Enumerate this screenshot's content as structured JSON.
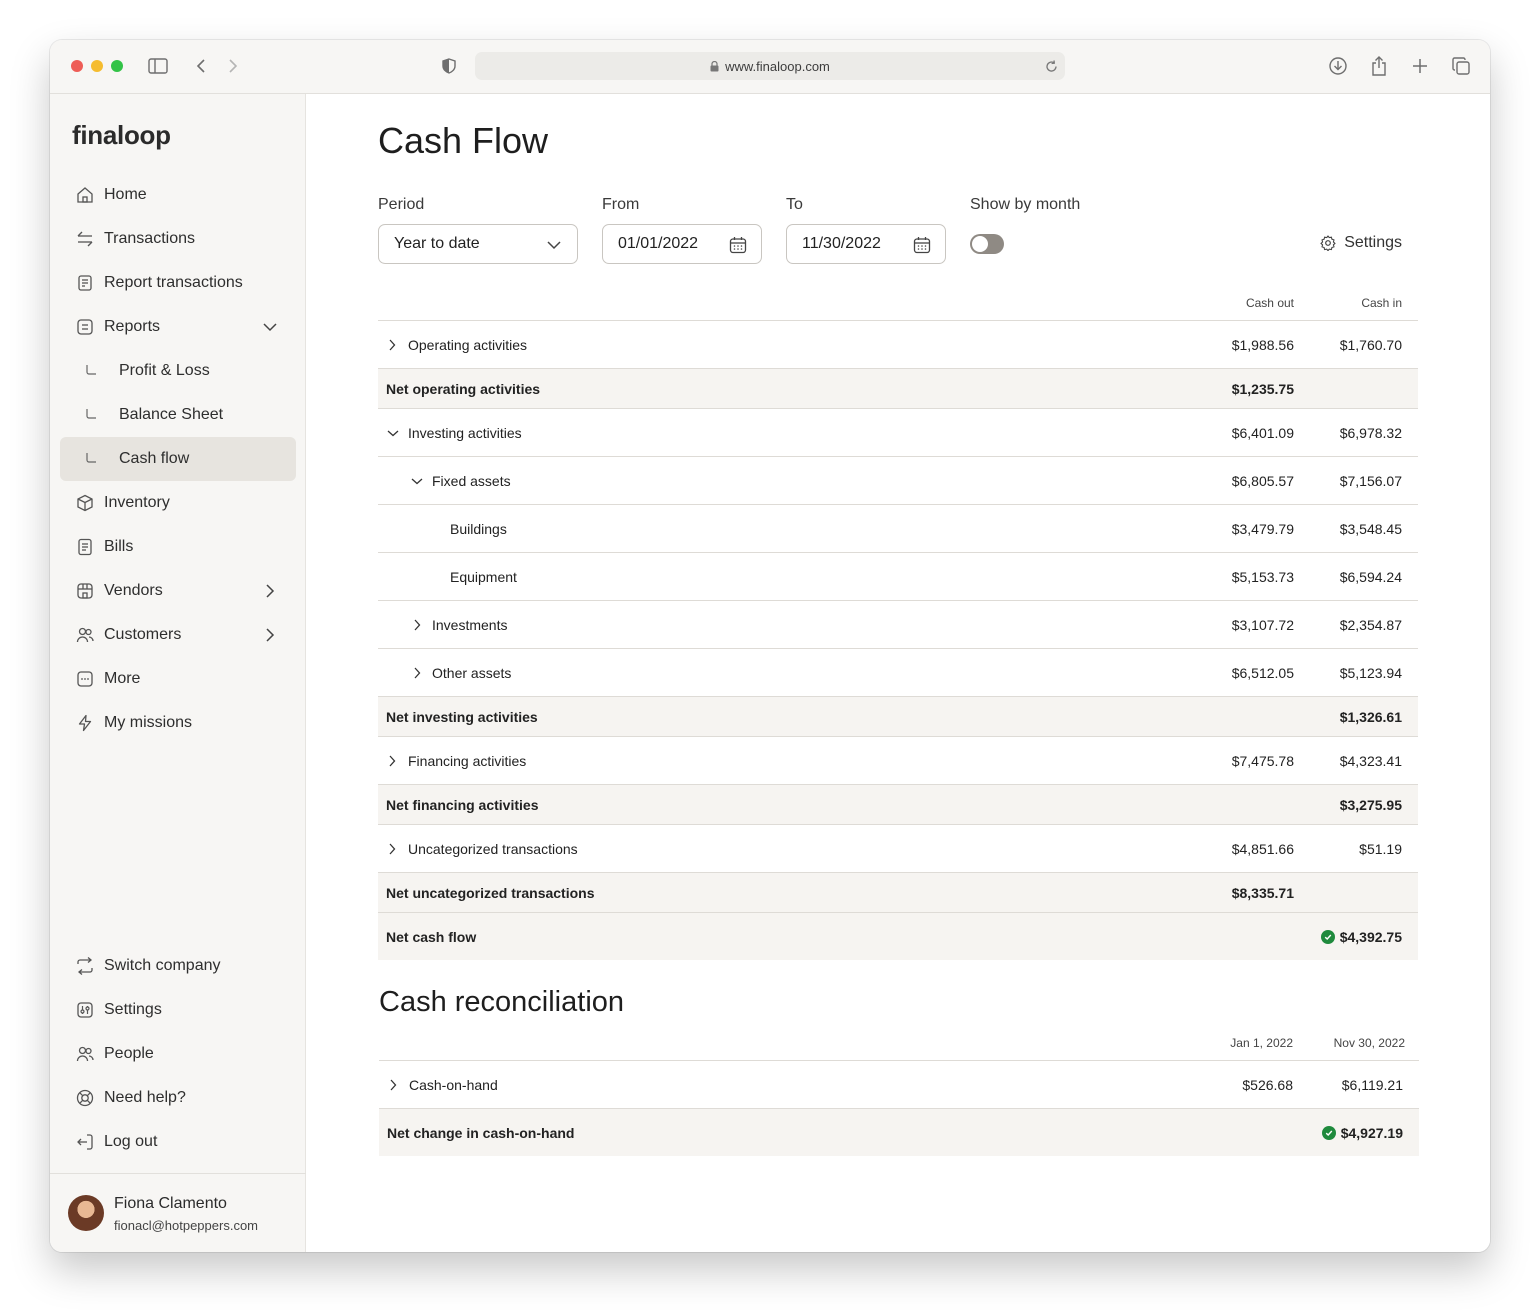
{
  "browser": {
    "url": "www.finaloop.com"
  },
  "sidebar": {
    "logo": "finaloop",
    "items": [
      {
        "label": "Home"
      },
      {
        "label": "Transactions"
      },
      {
        "label": "Report transactions"
      },
      {
        "label": "Reports"
      },
      {
        "label": "Profit & Loss"
      },
      {
        "label": "Balance Sheet"
      },
      {
        "label": "Cash flow"
      },
      {
        "label": "Inventory"
      },
      {
        "label": "Bills"
      },
      {
        "label": "Vendors"
      },
      {
        "label": "Customers"
      },
      {
        "label": "More"
      },
      {
        "label": "My missions"
      }
    ],
    "bottom_items": [
      {
        "label": "Switch company"
      },
      {
        "label": "Settings"
      },
      {
        "label": "People"
      },
      {
        "label": "Need help?"
      },
      {
        "label": "Log out"
      }
    ],
    "user": {
      "name": "Fiona Clamento",
      "email": "fionacl@hotpeppers.com"
    }
  },
  "main": {
    "title": "Cash Flow",
    "filters": {
      "period_label": "Period",
      "period_value": "Year to date",
      "from_label": "From",
      "from_value": "01/01/2022",
      "to_label": "To",
      "to_value": "11/30/2022",
      "show_by_month_label": "Show by month",
      "show_by_month_on": false,
      "settings_label": "Settings"
    },
    "cashflow": {
      "col_out": "Cash out",
      "col_in": "Cash in",
      "rows": [
        {
          "label": "Operating activities",
          "out": "$1,988.56",
          "in": "$1,760.70"
        },
        {
          "label": "Net operating activities",
          "out": "$1,235.75",
          "in": ""
        },
        {
          "label": "Investing activities",
          "out": "$6,401.09",
          "in": "$6,978.32"
        },
        {
          "label": "Fixed assets",
          "out": "$6,805.57",
          "in": "$7,156.07"
        },
        {
          "label": "Buildings",
          "out": "$3,479.79",
          "in": "$3,548.45"
        },
        {
          "label": "Equipment",
          "out": "$5,153.73",
          "in": "$6,594.24"
        },
        {
          "label": "Investments",
          "out": "$3,107.72",
          "in": "$2,354.87"
        },
        {
          "label": "Other assets",
          "out": "$6,512.05",
          "in": "$5,123.94"
        },
        {
          "label": "Net investing activities",
          "out": "",
          "in": "$1,326.61"
        },
        {
          "label": "Financing activities",
          "out": "$7,475.78",
          "in": "$4,323.41"
        },
        {
          "label": "Net financing activities",
          "out": "",
          "in": "$3,275.95"
        },
        {
          "label": "Uncategorized transactions",
          "out": "$4,851.66",
          "in": "$51.19"
        },
        {
          "label": "Net uncategorized transactions",
          "out": "$8,335.71",
          "in": ""
        },
        {
          "label": "Net cash flow",
          "out": "",
          "in": "$4,392.75"
        }
      ]
    },
    "reconciliation": {
      "title": "Cash reconciliation",
      "col_start": "Jan 1, 2022",
      "col_end": "Nov 30, 2022",
      "rows": [
        {
          "label": "Cash-on-hand",
          "start": "$526.68",
          "end": "$6,119.21"
        },
        {
          "label": "Net change in cash-on-hand",
          "start": "",
          "end": "$4,927.19"
        }
      ]
    },
    "colors": {
      "success": "#1f8a3d",
      "toggle_off": "#8f8a84",
      "sidebar_bg": "#f7f6f4",
      "active_bg": "#e7e4df"
    }
  }
}
